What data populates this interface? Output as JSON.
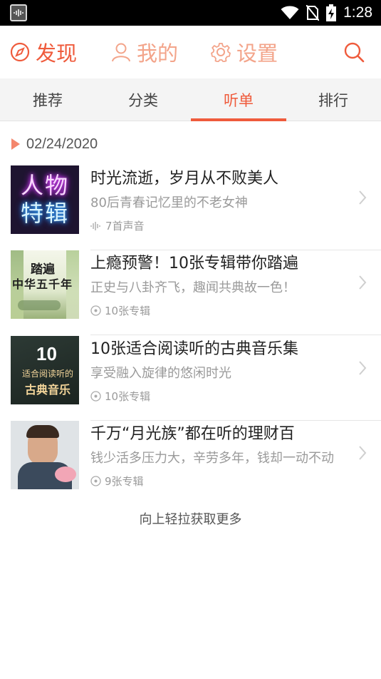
{
  "status_bar": {
    "time": "1:28",
    "icons": [
      "app-icon",
      "wifi-icon",
      "no-sim-icon",
      "battery-charging-icon"
    ]
  },
  "top_nav": {
    "discover_label": "发现",
    "mine_label": "我的",
    "settings_label": "设置",
    "icons": [
      "compass-icon",
      "user-icon",
      "gear-icon",
      "search-icon"
    ],
    "accent_color": "#ef5b3c",
    "inactive_color": "#f3a48a"
  },
  "tabs": [
    {
      "label": "推荐",
      "active": false
    },
    {
      "label": "分类",
      "active": false
    },
    {
      "label": "听单",
      "active": true
    },
    {
      "label": "排行",
      "active": false
    }
  ],
  "date": "02/24/2020",
  "items": [
    {
      "title": "时光流逝，岁月从不败美人",
      "subtitle": "80后青春记忆里的不老女神",
      "meta": "7首声音",
      "meta_icon": "waveform-icon",
      "thumb_text_line1": "人物",
      "thumb_text_line2": "特辑"
    },
    {
      "title": "上瘾预警！10张专辑带你踏遍",
      "subtitle": "正史与八卦齐飞，趣闻共典故一色！",
      "meta": "10张专辑",
      "meta_icon": "disc-icon",
      "thumb_text_line1": "踏遍",
      "thumb_text_line2": "中华五千年"
    },
    {
      "title": "10张适合阅读听的古典音乐集",
      "subtitle": "享受融入旋律的悠闲时光",
      "meta": "10张专辑",
      "meta_icon": "disc-icon",
      "thumb_text_line1": "10",
      "thumb_text_line2": "适合阅读听的",
      "thumb_text_line3": "古典音乐"
    },
    {
      "title": "千万“月光族”都在听的理财百",
      "subtitle": "钱少活多压力大，辛劳多年，钱却一动不动",
      "meta": "9张专辑",
      "meta_icon": "disc-icon"
    }
  ],
  "load_more": "向上轻拉获取更多"
}
